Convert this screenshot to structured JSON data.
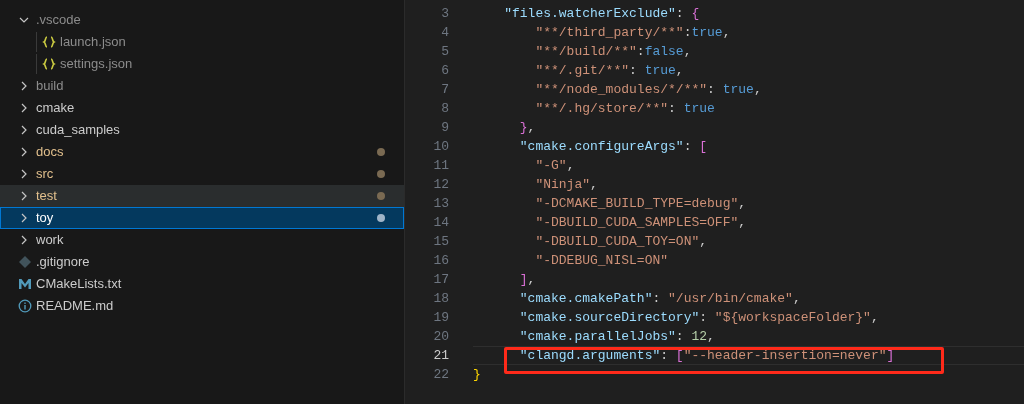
{
  "explorer": {
    "items": [
      {
        "label": ".vscode",
        "kind": "folder",
        "expanded": true,
        "ignored": true,
        "modified": false,
        "hovered": false,
        "selected": false,
        "children": [
          {
            "label": "launch.json",
            "kind": "json",
            "ignored": true,
            "modified": false,
            "hovered": false,
            "selected": false
          },
          {
            "label": "settings.json",
            "kind": "json",
            "ignored": true,
            "modified": false,
            "hovered": false,
            "selected": false
          }
        ]
      },
      {
        "label": "build",
        "kind": "folder",
        "expanded": false,
        "ignored": true,
        "modified": false,
        "hovered": false,
        "selected": false
      },
      {
        "label": "cmake",
        "kind": "folder",
        "expanded": false,
        "ignored": false,
        "modified": false,
        "hovered": false,
        "selected": false
      },
      {
        "label": "cuda_samples",
        "kind": "folder",
        "expanded": false,
        "ignored": false,
        "modified": false,
        "hovered": false,
        "selected": false
      },
      {
        "label": "docs",
        "kind": "folder",
        "expanded": false,
        "ignored": false,
        "modified": true,
        "hovered": false,
        "selected": false
      },
      {
        "label": "src",
        "kind": "folder",
        "expanded": false,
        "ignored": false,
        "modified": true,
        "hovered": false,
        "selected": false
      },
      {
        "label": "test",
        "kind": "folder",
        "expanded": false,
        "ignored": false,
        "modified": true,
        "hovered": true,
        "selected": false
      },
      {
        "label": "toy",
        "kind": "folder",
        "expanded": false,
        "ignored": false,
        "modified": true,
        "hovered": false,
        "selected": true
      },
      {
        "label": "work",
        "kind": "folder",
        "expanded": false,
        "ignored": false,
        "modified": false,
        "hovered": false,
        "selected": false
      },
      {
        "label": ".gitignore",
        "kind": "git",
        "ignored": false,
        "modified": false,
        "hovered": false,
        "selected": false
      },
      {
        "label": "CMakeLists.txt",
        "kind": "cmake",
        "ignored": false,
        "modified": false,
        "hovered": false,
        "selected": false
      },
      {
        "label": "README.md",
        "kind": "info",
        "ignored": false,
        "modified": false,
        "hovered": false,
        "selected": false
      }
    ]
  },
  "editor": {
    "lines": [
      {
        "number": "3",
        "current": false,
        "highlighted": false,
        "tokens": [
          {
            "kind": "key",
            "text": "    \"files.watcherExclude\""
          },
          {
            "kind": "punct",
            "text": ": "
          },
          {
            "kind": "bracket",
            "text": "{"
          }
        ]
      },
      {
        "number": "4",
        "current": false,
        "highlighted": false,
        "tokens": [
          {
            "kind": "string",
            "text": "        \"**/third_party/**\""
          },
          {
            "kind": "punct",
            "text": ":"
          },
          {
            "kind": "bool",
            "text": "true"
          },
          {
            "kind": "punct",
            "text": ","
          }
        ]
      },
      {
        "number": "5",
        "current": false,
        "highlighted": false,
        "tokens": [
          {
            "kind": "string",
            "text": "        \"**/build/**\""
          },
          {
            "kind": "punct",
            "text": ":"
          },
          {
            "kind": "bool",
            "text": "false"
          },
          {
            "kind": "punct",
            "text": ","
          }
        ]
      },
      {
        "number": "6",
        "current": false,
        "highlighted": false,
        "tokens": [
          {
            "kind": "string",
            "text": "        \"**/.git/**\""
          },
          {
            "kind": "punct",
            "text": ": "
          },
          {
            "kind": "bool",
            "text": "true"
          },
          {
            "kind": "punct",
            "text": ","
          }
        ]
      },
      {
        "number": "7",
        "current": false,
        "highlighted": false,
        "tokens": [
          {
            "kind": "string",
            "text": "        \"**/node_modules/*/**\""
          },
          {
            "kind": "punct",
            "text": ": "
          },
          {
            "kind": "bool",
            "text": "true"
          },
          {
            "kind": "punct",
            "text": ","
          }
        ]
      },
      {
        "number": "8",
        "current": false,
        "highlighted": false,
        "tokens": [
          {
            "kind": "string",
            "text": "        \"**/.hg/store/**\""
          },
          {
            "kind": "punct",
            "text": ": "
          },
          {
            "kind": "bool",
            "text": "true"
          }
        ]
      },
      {
        "number": "9",
        "current": false,
        "highlighted": false,
        "tokens": [
          {
            "kind": "bracket",
            "text": "      }"
          },
          {
            "kind": "punct",
            "text": ","
          }
        ]
      },
      {
        "number": "10",
        "current": false,
        "highlighted": false,
        "tokens": [
          {
            "kind": "key",
            "text": "      \"cmake.configureArgs\""
          },
          {
            "kind": "punct",
            "text": ": "
          },
          {
            "kind": "bracket",
            "text": "["
          }
        ]
      },
      {
        "number": "11",
        "current": false,
        "highlighted": false,
        "tokens": [
          {
            "kind": "string",
            "text": "        \"-G\""
          },
          {
            "kind": "punct",
            "text": ","
          }
        ]
      },
      {
        "number": "12",
        "current": false,
        "highlighted": false,
        "tokens": [
          {
            "kind": "string",
            "text": "        \"Ninja\""
          },
          {
            "kind": "punct",
            "text": ","
          }
        ]
      },
      {
        "number": "13",
        "current": false,
        "highlighted": false,
        "tokens": [
          {
            "kind": "string",
            "text": "        \"-DCMAKE_BUILD_TYPE=debug\""
          },
          {
            "kind": "punct",
            "text": ","
          }
        ]
      },
      {
        "number": "14",
        "current": false,
        "highlighted": false,
        "tokens": [
          {
            "kind": "string",
            "text": "        \"-DBUILD_CUDA_SAMPLES=OFF\""
          },
          {
            "kind": "punct",
            "text": ","
          }
        ]
      },
      {
        "number": "15",
        "current": false,
        "highlighted": false,
        "tokens": [
          {
            "kind": "string",
            "text": "        \"-DBUILD_CUDA_TOY=ON\""
          },
          {
            "kind": "punct",
            "text": ","
          }
        ]
      },
      {
        "number": "16",
        "current": false,
        "highlighted": false,
        "tokens": [
          {
            "kind": "string",
            "text": "        \"-DDEBUG_NISL=ON\""
          }
        ]
      },
      {
        "number": "17",
        "current": false,
        "highlighted": false,
        "tokens": [
          {
            "kind": "bracket",
            "text": "      ]"
          },
          {
            "kind": "punct",
            "text": ","
          }
        ]
      },
      {
        "number": "18",
        "current": false,
        "highlighted": false,
        "tokens": [
          {
            "kind": "key",
            "text": "      \"cmake.cmakePath\""
          },
          {
            "kind": "punct",
            "text": ": "
          },
          {
            "kind": "string",
            "text": "\"/usr/bin/cmake\""
          },
          {
            "kind": "punct",
            "text": ","
          }
        ]
      },
      {
        "number": "19",
        "current": false,
        "highlighted": false,
        "tokens": [
          {
            "kind": "key",
            "text": "      \"cmake.sourceDirectory\""
          },
          {
            "kind": "punct",
            "text": ": "
          },
          {
            "kind": "string",
            "text": "\"${workspaceFolder}\""
          },
          {
            "kind": "punct",
            "text": ","
          }
        ]
      },
      {
        "number": "20",
        "current": false,
        "highlighted": false,
        "tokens": [
          {
            "kind": "key",
            "text": "      \"cmake.parallelJobs\""
          },
          {
            "kind": "punct",
            "text": ": "
          },
          {
            "kind": "number",
            "text": "12"
          },
          {
            "kind": "punct",
            "text": ","
          }
        ]
      },
      {
        "number": "21",
        "current": true,
        "highlighted": true,
        "tokens": [
          {
            "kind": "key",
            "text": "      \"clangd.arguments\""
          },
          {
            "kind": "punct",
            "text": ": "
          },
          {
            "kind": "bracket",
            "text": "["
          },
          {
            "kind": "string",
            "text": "\"--header-insertion=never\""
          },
          {
            "kind": "bracket",
            "text": "]"
          }
        ]
      },
      {
        "number": "22",
        "current": false,
        "highlighted": false,
        "tokens": [
          {
            "kind": "brace",
            "text": "}"
          }
        ]
      }
    ]
  }
}
